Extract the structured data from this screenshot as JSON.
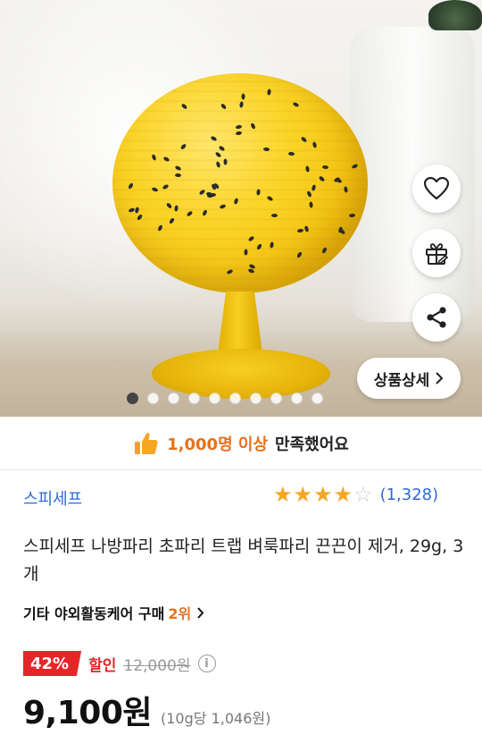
{
  "hero": {
    "slide_count": 10,
    "active_slide": 1,
    "buttons": {
      "wishlist_icon": "heart-icon",
      "gift_icon": "gift-icon",
      "share_icon": "share-icon"
    },
    "detail_button_label": "상품상세"
  },
  "satisfaction": {
    "highlight": "1,000명 이상",
    "rest": "만족했어요",
    "icon": "thumbs-up-icon"
  },
  "product": {
    "brand": "스피세프",
    "rating_stars": 4,
    "rating_max": 5,
    "review_count": "(1,328)",
    "title": "스피세프 나방파리 초파리 트랩 벼룩파리 끈끈이 제거, 29g, 3개",
    "category": {
      "prefix": "기타 야외활동케어 구매",
      "rank": "2위",
      "chevron": "›"
    }
  },
  "pricing": {
    "discount_badge": "42%",
    "sale_label": "할인",
    "original_price": "12,000원",
    "info_icon": "i",
    "price": "9,100원",
    "unit_price": "(10g당 1,046원)"
  },
  "colors": {
    "accent_orange": "#e5711d",
    "link_blue": "#2d6ad6",
    "discount_red": "#e52528",
    "star_yellow": "#f5a623"
  }
}
